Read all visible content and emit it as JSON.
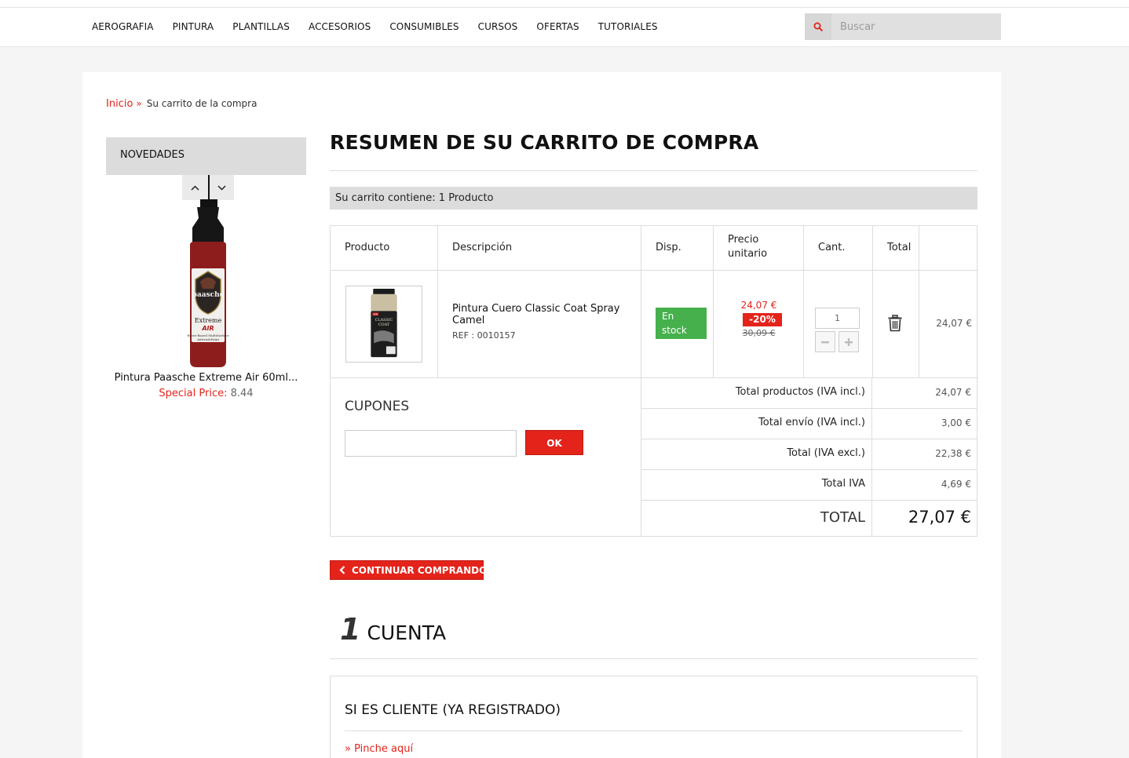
{
  "nav": {
    "items": [
      "AEROGRAFIA",
      "PINTURA",
      "PLANTILLAS",
      "ACCESORIOS",
      "CONSUMIBLES",
      "CURSOS",
      "OFERTAS",
      "TUTORIALES"
    ]
  },
  "search": {
    "placeholder": "Buscar",
    "icon": "search-icon"
  },
  "breadcrumb": {
    "home": "Inicio",
    "separator": "»",
    "current": "Su carrito de la compra"
  },
  "sidebar": {
    "heading": "NOVEDADES",
    "product": {
      "name": "Pintura Paasche Extreme Air 60ml...",
      "price_label": "Special Price:",
      "price_value": "8.44"
    },
    "bottle_label": {
      "brand": "paasche",
      "line1": "Extreme",
      "line2": "AIR",
      "line3": "Water-Based MultiSurface",
      "line4": "AirbrushPaint"
    }
  },
  "main": {
    "title": "RESUMEN DE SU CARRITO DE COMPRA",
    "summary": "Su carrito contiene: 1 Producto",
    "columns": {
      "producto": "Producto",
      "descripcion": "Descripción",
      "disp": "Disp.",
      "precio_line1": "Precio",
      "precio_line2": "unitario",
      "cant": "Cant.",
      "total": "Total"
    },
    "item": {
      "name": "Pintura Cuero Classic Coat Spray Camel",
      "ref": "REF : 0010157",
      "stock_line1": "En",
      "stock_line2": "stock",
      "price_new": "24,07 €",
      "discount": "-20%",
      "price_old": "30,09 €",
      "quantity": "1",
      "total": "24,07 €",
      "can_brand": "SEM",
      "can_label1": "CLASSIC",
      "can_label2": "COAT"
    },
    "coupons": {
      "title": "CUPONES",
      "button": "OK"
    },
    "totals": [
      {
        "label": "Total productos (IVA incl.)",
        "value": "24,07 €"
      },
      {
        "label": "Total envío (IVA incl.)",
        "value": "3,00 €"
      },
      {
        "label": "Total (IVA excl.)",
        "value": "22,38 €"
      },
      {
        "label": "Total IVA",
        "value": "4,69 €"
      }
    ],
    "grand_total": {
      "label": "TOTAL",
      "value": "27,07 €"
    },
    "continue_button": "CONTINUAR COMPRANDO",
    "step": {
      "number": "1",
      "label": "CUENTA"
    },
    "login": {
      "title": "SI ES CLIENTE (YA REGISTRADO)",
      "link": "» Pinche aquí"
    }
  },
  "colors": {
    "accent": "#e4231b",
    "stock": "#46b04d",
    "header_gray": "#dcdcdc"
  }
}
